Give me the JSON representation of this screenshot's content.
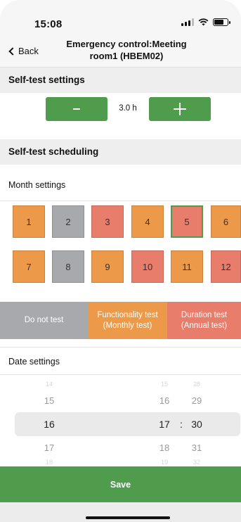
{
  "status_bar": {
    "time": "15:08"
  },
  "nav": {
    "back_label": "Back",
    "title_line1": "Emergency control:Meeting",
    "title_line2": "room1 (HBEM02)"
  },
  "self_test_settings": {
    "header": "Self-test settings",
    "minus_label": "-",
    "value": "3.0 h"
  },
  "self_test_scheduling": {
    "header": "Self-test scheduling",
    "month_settings_label": "Month settings",
    "months": [
      {
        "label": "1",
        "status": "functionality"
      },
      {
        "label": "2",
        "status": "none"
      },
      {
        "label": "3",
        "status": "duration"
      },
      {
        "label": "4",
        "status": "functionality"
      },
      {
        "label": "5",
        "status": "duration",
        "selected": true
      },
      {
        "label": "6",
        "status": "functionality"
      },
      {
        "label": "7",
        "status": "functionality"
      },
      {
        "label": "8",
        "status": "none"
      },
      {
        "label": "9",
        "status": "functionality"
      },
      {
        "label": "10",
        "status": "duration"
      },
      {
        "label": "11",
        "status": "functionality"
      },
      {
        "label": "12",
        "status": "duration"
      }
    ],
    "legend": {
      "none": "Do not test",
      "functionality_line1": "Functionality test",
      "functionality_line2": "(Monthly test)",
      "duration_line1": "Duration test",
      "duration_line2": "(Annual test)"
    },
    "date_settings_label": "Date settings"
  },
  "picker": {
    "day": {
      "above_far": "14",
      "above": "15",
      "selected": "16",
      "below": "17",
      "below_far": "18"
    },
    "hour": {
      "above_far": "15",
      "above": "16",
      "selected": "17",
      "below": "18",
      "below_far": "19"
    },
    "minute": {
      "above_far": "28",
      "above": "29",
      "selected": "30",
      "below": "31",
      "below_far": "32"
    },
    "separator": ":"
  },
  "save_label": "Save",
  "colors": {
    "accent_green": "#4e9c4c",
    "functionality_orange": "#ec9a4a",
    "duration_red": "#e87d6c",
    "none_gray": "#a8a9ad"
  }
}
